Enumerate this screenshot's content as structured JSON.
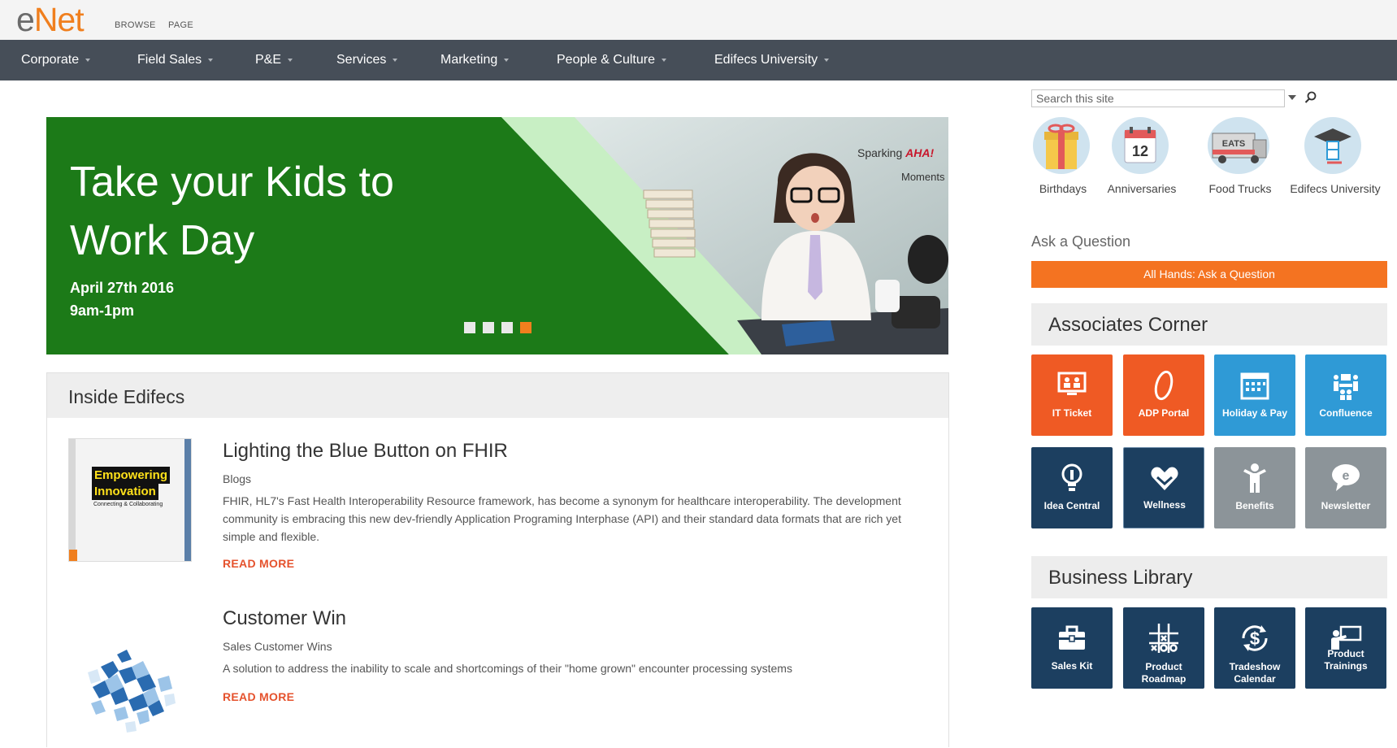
{
  "header": {
    "logo_e": "e",
    "logo_net": "Net",
    "links": [
      "BROWSE",
      "PAGE"
    ]
  },
  "nav": {
    "items": [
      "Corporate",
      "Field Sales",
      "P&E",
      "Services",
      "Marketing",
      "People & Culture",
      "Edifecs University"
    ]
  },
  "hero": {
    "title": "Take your Kids to Work Day",
    "date": "April 27th 2016",
    "time": "9am-1pm",
    "badge_line1": "Sparking",
    "badge_aha": "AHA!",
    "badge_line2": "Moments",
    "slides_total": 4,
    "slide_active": 4,
    "colors": {
      "green": "#1c7a18",
      "accent": "#f07f1e"
    }
  },
  "inside": {
    "title": "Inside Edifecs",
    "articles": [
      {
        "title": "Lighting the Blue Button on FHIR",
        "category": "Blogs",
        "body": "FHIR, HL7's Fast Health Interoperability Resource framework, has become a synonym for healthcare interoperability. The development community is embracing this new dev-friendly Application Programing Interphase (API) and their standard data formats that are rich yet simple and flexible.",
        "read_more": "READ MORE",
        "thumb_text": [
          "Empowering",
          "Innovation",
          "Connecting & Collaborating"
        ]
      },
      {
        "title": "Customer Win",
        "category": "Sales Customer Wins",
        "body": "A solution to address the inability to scale and shortcomings of their \"home grown\" encounter processing systems",
        "read_more": "READ MORE"
      }
    ]
  },
  "sidebar": {
    "search_placeholder": "Search this site",
    "quick_links": [
      {
        "label": "Birthdays",
        "icon": "gift-icon"
      },
      {
        "label": "Anniversaries",
        "icon": "calendar-icon"
      },
      {
        "label": "Food Trucks",
        "icon": "food-truck-icon"
      },
      {
        "label": "Edifecs University",
        "icon": "graduation-icon"
      }
    ],
    "calendar_number": "12",
    "truck_text": "EATS",
    "ask_heading": "Ask a Question",
    "ask_button": "All Hands: Ask a Question",
    "associates_title": "Associates Corner",
    "associates": [
      {
        "label": "IT Ticket",
        "icon": "monitor-people-icon",
        "color": "#ef5a24"
      },
      {
        "label": "ADP Portal",
        "icon": "adp-icon",
        "color": "#ef5a24"
      },
      {
        "label": "Holiday & Pay",
        "icon": "calendar-grid-icon",
        "color": "#2f9ad6"
      },
      {
        "label": "Confluence",
        "icon": "team-icon",
        "color": "#2f9ad6"
      },
      {
        "label": "Idea Central",
        "icon": "lightbulb-icon",
        "color": "#1c3f60"
      },
      {
        "label": "Wellness",
        "icon": "heart-hands-icon",
        "color": "#1c3f60"
      },
      {
        "label": "Benefits",
        "icon": "person-icon",
        "color": "#8c9499"
      },
      {
        "label": "Newsletter",
        "icon": "speech-e-icon",
        "color": "#8c9499"
      }
    ],
    "library_title": "Business Library",
    "library": [
      {
        "label": "Sales Kit",
        "icon": "briefcase-icon",
        "color": "#1c3f60"
      },
      {
        "label": "Product Roadmap",
        "icon": "tic-tac-toe-icon",
        "color": "#1c3f60"
      },
      {
        "label": "Tradeshow Calendar",
        "icon": "dollar-cycle-icon",
        "color": "#1c3f60"
      },
      {
        "label": "Product Trainings",
        "icon": "presenter-icon",
        "color": "#1c3f60"
      }
    ]
  }
}
